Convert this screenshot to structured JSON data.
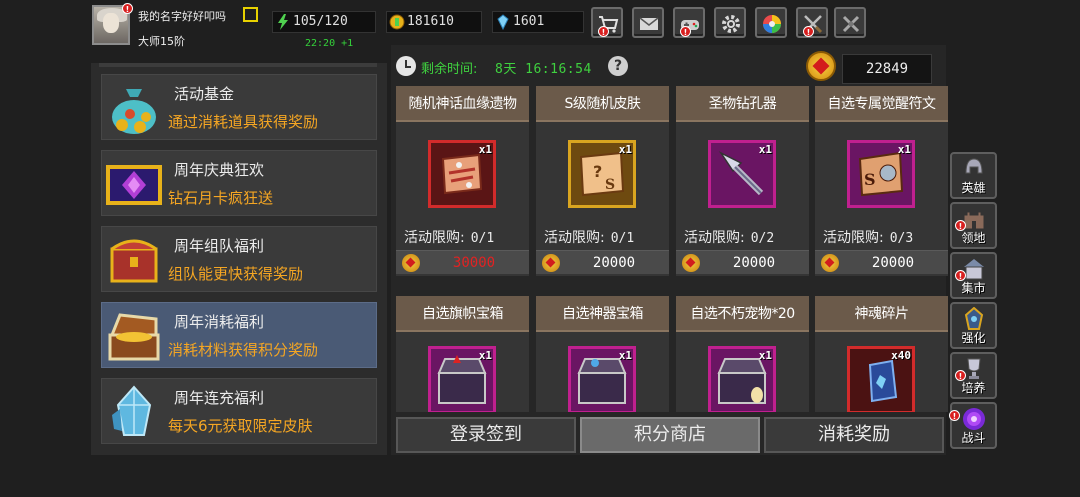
{
  "player": {
    "name": "我的名字好好叩吗",
    "rank": "大师15阶",
    "regen": "22:20 +1"
  },
  "resources": {
    "stamina": "105/120",
    "gold": "181610",
    "gems": "1601"
  },
  "top_buttons": [
    "shop-cart-icon",
    "mail-icon",
    "gamepad-icon",
    "gear-icon",
    "color-wheel-icon",
    "swords-icon",
    "crossed-blades-icon"
  ],
  "events": [
    {
      "title": "活动基金",
      "desc": "通过消耗道具获得奖励",
      "icon": "money-bag-icon"
    },
    {
      "title": "周年庆典狂欢",
      "desc": "钻石月卡疯狂送",
      "icon": "diamond-card-icon"
    },
    {
      "title": "周年组队福利",
      "desc": "组队能更快获得奖励",
      "icon": "chest-icon"
    },
    {
      "title": "周年消耗福利",
      "desc": "消耗材料获得积分奖励",
      "icon": "treasure-chest-icon"
    },
    {
      "title": "周年连充福利",
      "desc": "每天6元获取限定皮肤",
      "icon": "crystal-icon"
    }
  ],
  "shop": {
    "timer_label": "剩余时间:",
    "timer_value": "8天 16:16:54",
    "points": "22849",
    "limit_label": "活动限购:",
    "items": [
      {
        "title": "随机神话血缘遗物",
        "qty": "x1",
        "limit": "0/1",
        "price": "30000",
        "frame": "red",
        "price_red": true
      },
      {
        "title": "S级随机皮肤",
        "qty": "x1",
        "limit": "0/1",
        "price": "20000",
        "frame": "gold",
        "price_red": false
      },
      {
        "title": "圣物钻孔器",
        "qty": "x1",
        "limit": "0/2",
        "price": "20000",
        "frame": "purple",
        "price_red": false
      },
      {
        "title": "自选专属觉醒符文",
        "qty": "x1",
        "limit": "0/3",
        "price": "20000",
        "frame": "purple",
        "price_red": false
      },
      {
        "title": "自选旗帜宝箱",
        "qty": "x1",
        "frame": "purple"
      },
      {
        "title": "自选神器宝箱",
        "qty": "x1",
        "frame": "purple"
      },
      {
        "title": "自选不朽宠物*20",
        "qty": "x1",
        "frame": "purple"
      },
      {
        "title": "神魂碎片",
        "qty": "x40",
        "frame": "red"
      }
    ]
  },
  "tabs": [
    {
      "label": "登录签到",
      "active": false
    },
    {
      "label": "积分商店",
      "active": true
    },
    {
      "label": "消耗奖励",
      "active": false
    }
  ],
  "sidebar": [
    {
      "label": "英雄",
      "icon": "helmet-icon"
    },
    {
      "label": "领地",
      "icon": "castle-icon"
    },
    {
      "label": "集市",
      "icon": "market-icon"
    },
    {
      "label": "强化",
      "icon": "enhance-icon"
    },
    {
      "label": "培养",
      "icon": "trophy-icon"
    },
    {
      "label": "战斗",
      "icon": "portal-icon"
    }
  ],
  "colors": {
    "accent_green": "#3fd13f",
    "accent_orange": "#f5a623",
    "price_red": "#e22222",
    "selected_item": "#4a5a75"
  }
}
